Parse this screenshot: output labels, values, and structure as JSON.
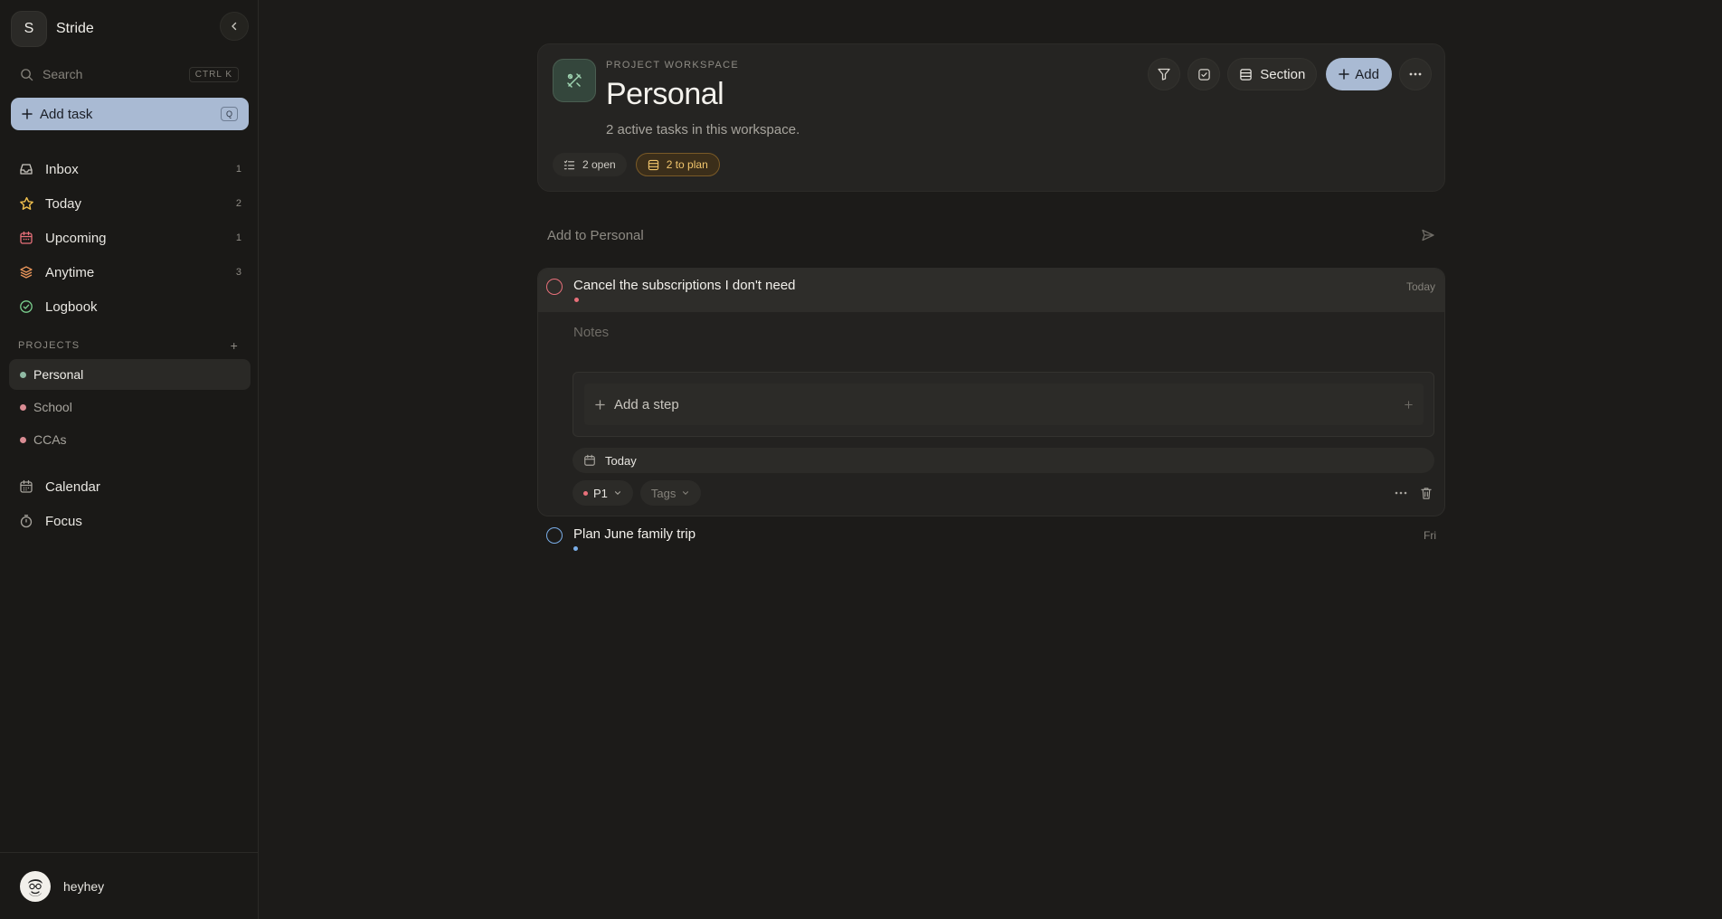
{
  "app": {
    "logo_letter": "S",
    "name": "Stride"
  },
  "search": {
    "placeholder": "Search",
    "shortcut": "CTRL K"
  },
  "add_task": {
    "label": "Add task",
    "shortcut": "Q"
  },
  "nav": [
    {
      "label": "Inbox",
      "count": "1",
      "icon": "inbox-icon",
      "color": "#c9c6bf"
    },
    {
      "label": "Today",
      "count": "2",
      "icon": "star-icon",
      "color": "#f2c14e"
    },
    {
      "label": "Upcoming",
      "count": "1",
      "icon": "calendar-icon",
      "color": "#e8707a"
    },
    {
      "label": "Anytime",
      "count": "3",
      "icon": "layers-icon",
      "color": "#e8955a"
    },
    {
      "label": "Logbook",
      "count": "",
      "icon": "check-circle-icon",
      "color": "#7bd08f"
    }
  ],
  "projects_section": {
    "title": "PROJECTS",
    "add": "+"
  },
  "projects": [
    {
      "label": "Personal",
      "color": "#8fb9a3",
      "active": true
    },
    {
      "label": "School",
      "color": "#d98c93",
      "active": false
    },
    {
      "label": "CCAs",
      "color": "#d98c93",
      "active": false
    }
  ],
  "nav2": [
    {
      "label": "Calendar",
      "icon": "calendar-grid-icon"
    },
    {
      "label": "Focus",
      "icon": "timer-icon"
    }
  ],
  "user": {
    "name": "heyhey"
  },
  "header": {
    "eyebrow": "PROJECT WORKSPACE",
    "title": "Personal",
    "subtitle": "2 active tasks in this workspace.",
    "chip_open": "2 open",
    "chip_plan": "2 to plan",
    "section_label": "Section",
    "add_label": "Add",
    "accent": "#a9bad3"
  },
  "quick_add": {
    "placeholder": "Add to Personal"
  },
  "tasks": [
    {
      "title": "Cancel the subscriptions I don't need",
      "when": "Today",
      "priority_color": "#e8707a",
      "notes_placeholder": "Notes",
      "add_step": "Add a step",
      "date": "Today",
      "priority": "P1",
      "tags": "Tags"
    },
    {
      "title": "Plan June family trip",
      "when": "Fri",
      "priority_color": "#7aaee8"
    }
  ]
}
